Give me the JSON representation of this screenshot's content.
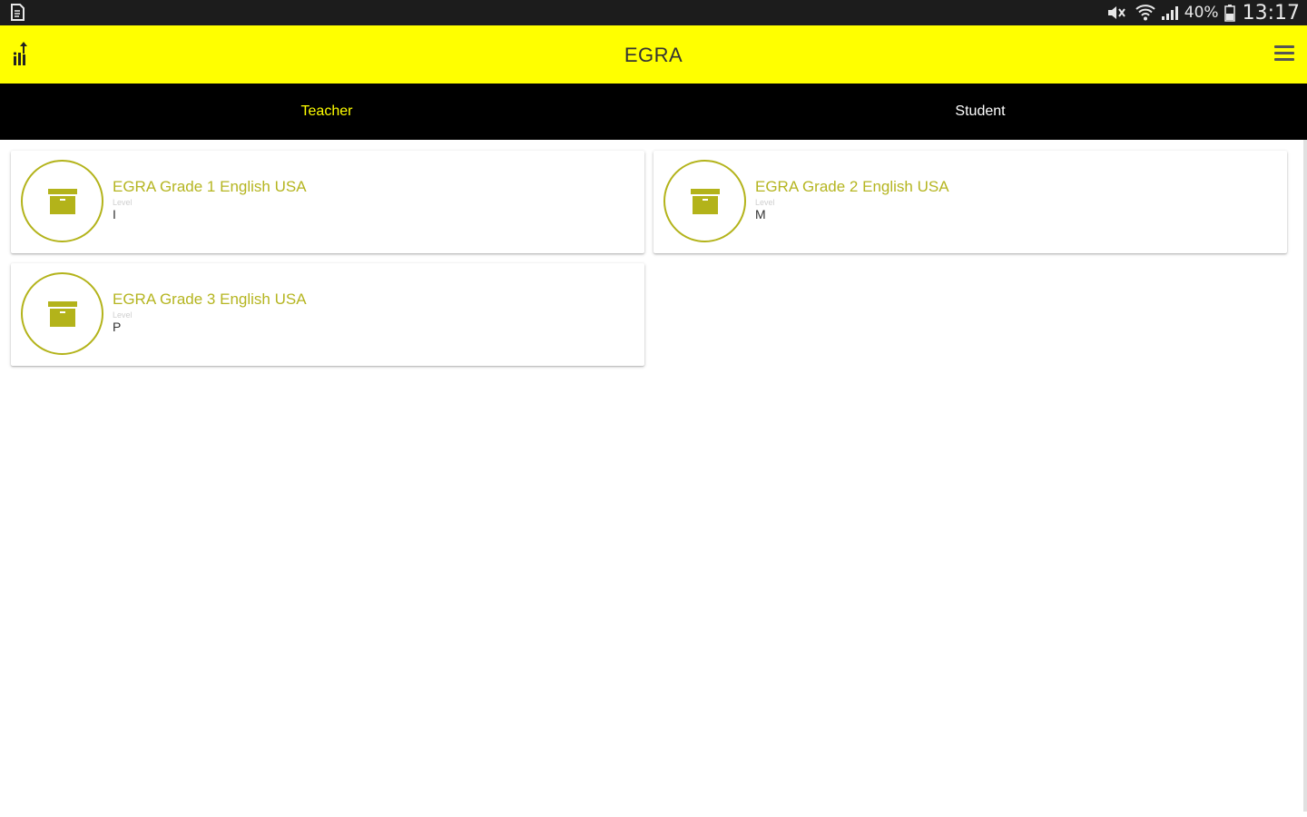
{
  "status_bar": {
    "battery_percent": "40%",
    "time": "13:17",
    "icons": [
      "document-icon",
      "mute-icon",
      "wifi-icon",
      "signal-icon",
      "battery-icon"
    ]
  },
  "app_bar": {
    "title": "EGRA",
    "logo_icon": "tangerine-logo-icon",
    "menu_icon": "hamburger-menu-icon",
    "color": "#ffff00"
  },
  "tabs": [
    {
      "label": "Teacher",
      "active": true
    },
    {
      "label": "Student",
      "active": false
    }
  ],
  "cards": [
    {
      "title": "EGRA Grade 1 English USA",
      "level_label": "Level",
      "level_value": "I",
      "icon": "archive-box-icon"
    },
    {
      "title": "EGRA Grade 2 English USA",
      "level_label": "Level",
      "level_value": "M",
      "icon": "archive-box-icon"
    },
    {
      "title": "EGRA Grade 3 English USA",
      "level_label": "Level",
      "level_value": "P",
      "icon": "archive-box-icon"
    }
  ],
  "colors": {
    "accent": "#ffff00",
    "card_title": "#b5b520",
    "tab_bar": "#000000"
  }
}
